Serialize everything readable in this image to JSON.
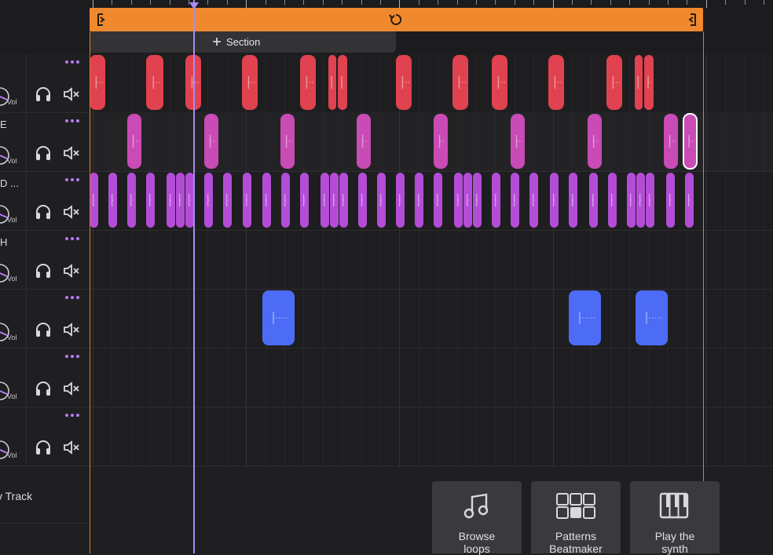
{
  "section": {
    "add_label": "Section"
  },
  "tracks": [
    {
      "name": "",
      "vol_label": "Vol"
    },
    {
      "name": "E",
      "vol_label": "Vol"
    },
    {
      "name": "D ...",
      "vol_label": "Vol"
    },
    {
      "name": "H",
      "vol_label": "Vol"
    },
    {
      "name": "",
      "vol_label": "Vol"
    },
    {
      "name": "",
      "vol_label": "Vol"
    },
    {
      "name": "",
      "vol_label": "Vol"
    }
  ],
  "new_track": {
    "label": "v Track"
  },
  "actions": [
    {
      "line1": "Browse",
      "line2": "loops",
      "icon": "music-note-icon"
    },
    {
      "line1": "Patterns",
      "line2": "Beatmaker",
      "icon": "beatmaker-pads-icon"
    },
    {
      "line1": "Play the",
      "line2": "synth",
      "icon": "piano-keys-icon"
    }
  ],
  "colors": {
    "loop": "#f0892e",
    "playhead": "#a98cf0",
    "clip_red": "#e0424f",
    "clip_pink": "#c94bb5",
    "clip_purple": "#b44dd6",
    "clip_blue": "#4c6cf5",
    "accent_purple": "#b77cf2"
  }
}
